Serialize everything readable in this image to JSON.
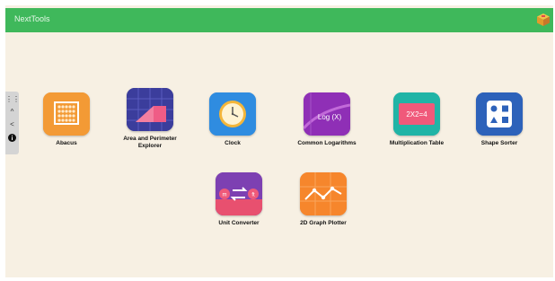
{
  "app": {
    "title": "NextTools"
  },
  "topbar": {
    "color": "#3fb85b"
  },
  "sidebar": {
    "items": [
      "grip-icon",
      "chevron-up-icon",
      "arrow-left-icon",
      "info-icon"
    ]
  },
  "tools": [
    {
      "label": "Abacus",
      "icon": "abacus-icon"
    },
    {
      "label": "Area and Perimeter Explorer",
      "icon": "area-perimeter-icon"
    },
    {
      "label": "Clock",
      "icon": "clock-icon"
    },
    {
      "label": "Common Logarithms",
      "icon": "logarithm-icon",
      "icon_text": "Log (X)"
    },
    {
      "label": "Multiplication Table",
      "icon": "multiplication-icon",
      "icon_text": "2X2=4"
    },
    {
      "label": "Shape Sorter",
      "icon": "shape-sorter-icon"
    },
    {
      "label": "Unit Converter",
      "icon": "unit-converter-icon",
      "icon_text_left": "m",
      "icon_text_right": "ft"
    },
    {
      "label": "2D Graph Plotter",
      "icon": "graph-plotter-icon"
    }
  ]
}
